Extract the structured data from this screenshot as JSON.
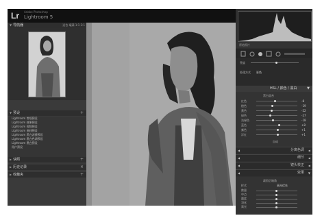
{
  "app": {
    "logo": "Lr",
    "subtitle": "Adobe Photoshop",
    "title": "Lightroom 5"
  },
  "left_panel": {
    "navigator_title": "导航器",
    "navigator_options": [
      "适合",
      "填满",
      "1:1",
      "3:1"
    ],
    "presets_title": "预设",
    "presets": [
      "Lightroom 常规预设",
      "Lightroom 效果预设",
      "Lightroom 视频预设",
      "Lightroom 曲线预设",
      "Lightroom 黑白滤镜预设",
      "Lightroom 黑白色调预设",
      "Lightroom 黑白预设",
      "用户预设"
    ],
    "snapshots_title": "快照",
    "history_title": "历史记录",
    "collections_title": "收藏夹"
  },
  "right_panel": {
    "original_label": "原始照片",
    "brightness_label": "亮度",
    "treatment_label": "处理方式",
    "treatment_value": "彩色",
    "hsl_title": "HSL / 颜色 / 黑白",
    "bw_mix_label": "黑白混合",
    "bw_sliders": [
      {
        "label": "红色",
        "value": "-8"
      },
      {
        "label": "橙色",
        "value": "-19"
      },
      {
        "label": "黄色",
        "value": "-22"
      },
      {
        "label": "绿色",
        "value": "-27"
      },
      {
        "label": "浅绿色",
        "value": "-18"
      },
      {
        "label": "蓝色",
        "value": "+8"
      },
      {
        "label": "紫色",
        "value": "+1"
      },
      {
        "label": "洋红",
        "value": "+1"
      }
    ],
    "auto_label": "自动",
    "split_tone_title": "分离色调",
    "detail_title": "细节",
    "lens_title": "镜头校正",
    "effects_title": "效果",
    "vignette_label": "裁剪后暗角",
    "style_label": "样式",
    "style_value": "高光优先",
    "effect_sliders": [
      "数量",
      "中点",
      "圆度",
      "羽化",
      "高光"
    ]
  },
  "colors": {
    "panel_bg": "#3a3a3a",
    "titlebar": "#111111",
    "photo_bg": "#a9a9a9"
  }
}
